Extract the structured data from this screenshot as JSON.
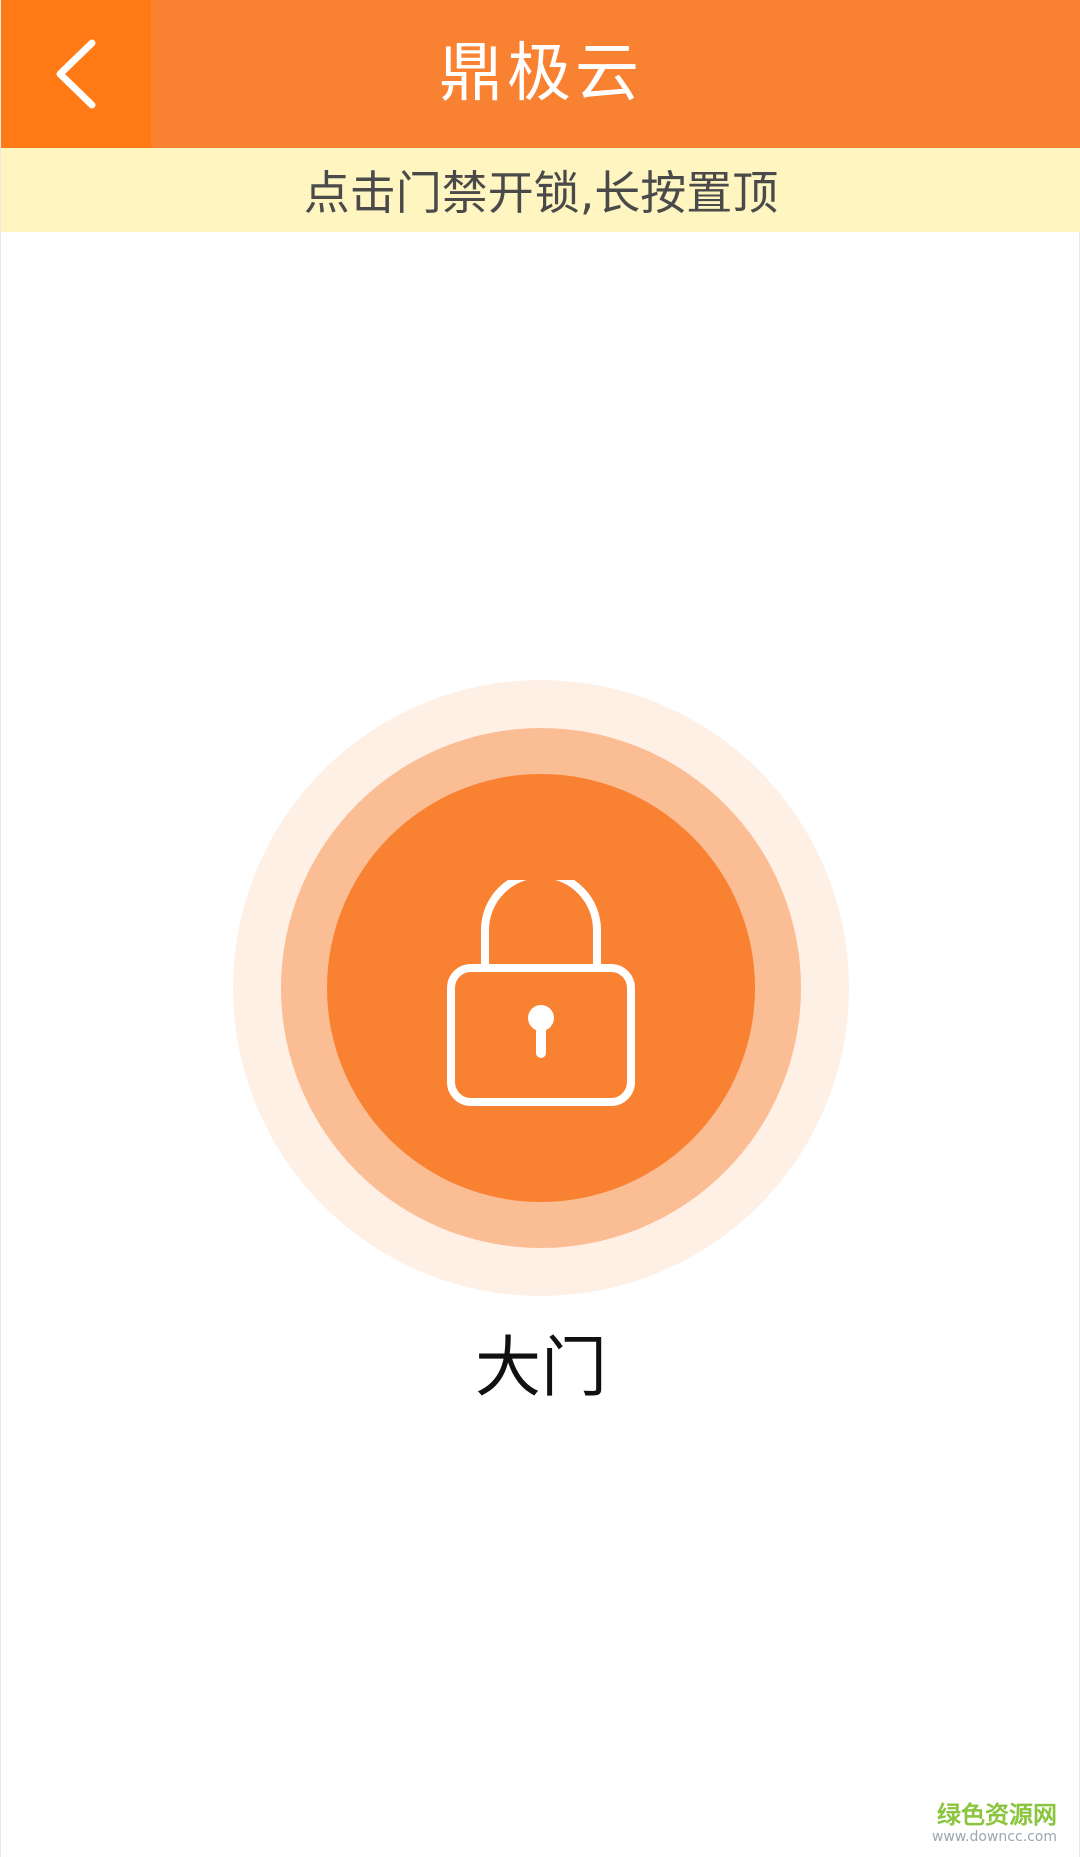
{
  "header": {
    "title": "鼎极云",
    "back_icon": "chevron-left-icon",
    "colors": {
      "background": "#f98132",
      "back_button_background": "#ff7a14",
      "text": "#ffffff"
    }
  },
  "tipbar": {
    "text": "点击门禁开锁,长按置顶",
    "colors": {
      "background": "#fef5c0",
      "text": "#4a4a4a"
    }
  },
  "door": {
    "label": "大门",
    "icon": "lock-icon",
    "colors": {
      "outer_ring": "#fff0e6",
      "middle_ring": "#fbbd93",
      "inner_circle": "#f98132",
      "icon_stroke": "#ffffff"
    }
  },
  "watermark": {
    "cn": "绿色资源网",
    "en": "www.downcc.com"
  }
}
